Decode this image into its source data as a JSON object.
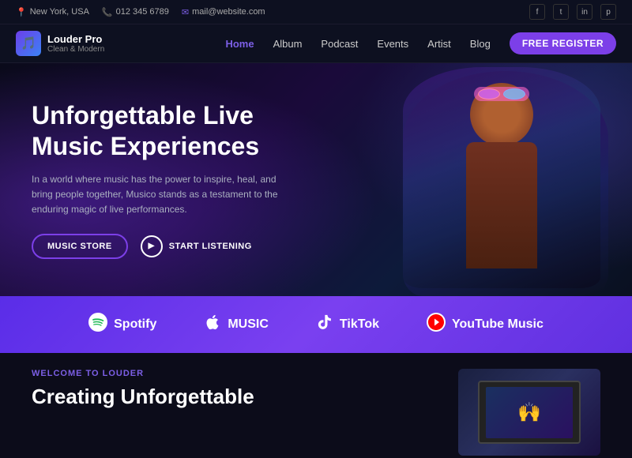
{
  "topbar": {
    "location": "New York, USA",
    "phone": "012 345 6789",
    "email": "mail@website.com",
    "socials": [
      "f",
      "t",
      "in",
      "p"
    ]
  },
  "navbar": {
    "brand_name": "Louder Pro",
    "brand_tagline": "Clean & Modern",
    "links": [
      "Home",
      "Album",
      "Podcast",
      "Events",
      "Artist",
      "Blog"
    ],
    "active_link": "Home",
    "cta_button": "FREE REGISTER"
  },
  "hero": {
    "title_line1": "Unforgettable Live",
    "title_line2": "Music Experiences",
    "description": "In a world where music has the power to inspire, heal, and bring people together, Musico stands as a testament to the enduring magic of live performances.",
    "btn_store": "MUSIC STORE",
    "btn_listen": "START LISTENING"
  },
  "partners": [
    {
      "name": "Spotify",
      "icon": "♪"
    },
    {
      "name": "MUSIC",
      "icon": ""
    },
    {
      "name": "TikTok",
      "icon": "♫"
    },
    {
      "name": "YouTube Music",
      "icon": "▶"
    }
  ],
  "bottom": {
    "welcome_label": "WELCOME TO LOUDER",
    "title_line1": "Creating Unforgettable"
  }
}
